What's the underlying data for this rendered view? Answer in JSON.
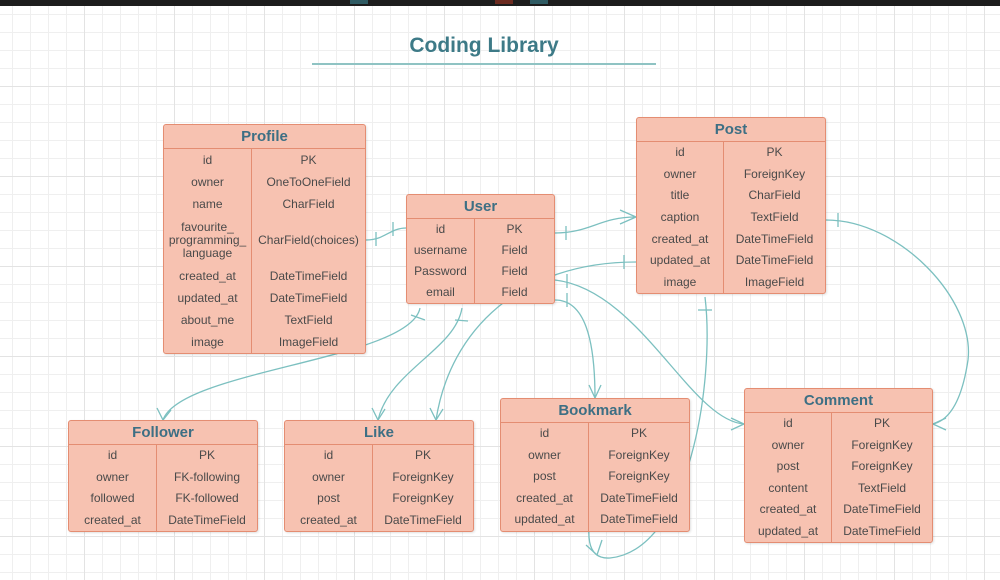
{
  "diagram": {
    "title": "Coding Library",
    "colors": {
      "entity_fill": "#f7c2b1",
      "entity_border": "#e48d72",
      "header_text": "#3d6f84",
      "connector": "#7cc0c0",
      "title": "#3d7a87"
    }
  },
  "entities": {
    "profile": {
      "name": "Profile",
      "fields": [
        {
          "field": "id",
          "type": "PK"
        },
        {
          "field": "owner",
          "type": "OneToOneField"
        },
        {
          "field": "name",
          "type": "CharField"
        },
        {
          "field": "favourite_\nprogramming_\nlanguage",
          "type": "CharField(choices)"
        },
        {
          "field": "created_at",
          "type": "DateTimeField"
        },
        {
          "field": "updated_at",
          "type": "DateTimeField"
        },
        {
          "field": "about_me",
          "type": "TextField"
        },
        {
          "field": "image",
          "type": "ImageField"
        }
      ]
    },
    "user": {
      "name": "User",
      "fields": [
        {
          "field": "id",
          "type": "PK"
        },
        {
          "field": "username",
          "type": "Field"
        },
        {
          "field": "Password",
          "type": "Field"
        },
        {
          "field": "email",
          "type": "Field"
        }
      ]
    },
    "post": {
      "name": "Post",
      "fields": [
        {
          "field": "id",
          "type": "PK"
        },
        {
          "field": "owner",
          "type": "ForeignKey"
        },
        {
          "field": "title",
          "type": "CharField"
        },
        {
          "field": "caption",
          "type": "TextField"
        },
        {
          "field": "created_at",
          "type": "DateTimeField"
        },
        {
          "field": "updated_at",
          "type": "DateTimeField"
        },
        {
          "field": "image",
          "type": "ImageField"
        }
      ]
    },
    "follower": {
      "name": "Follower",
      "fields": [
        {
          "field": "id",
          "type": "PK"
        },
        {
          "field": "owner",
          "type": "FK-following"
        },
        {
          "field": "followed",
          "type": "FK-followed"
        },
        {
          "field": "created_at",
          "type": "DateTimeField"
        }
      ]
    },
    "like": {
      "name": "Like",
      "fields": [
        {
          "field": "id",
          "type": "PK"
        },
        {
          "field": "owner",
          "type": "ForeignKey"
        },
        {
          "field": "post",
          "type": "ForeignKey"
        },
        {
          "field": "created_at",
          "type": "DateTimeField"
        }
      ]
    },
    "bookmark": {
      "name": "Bookmark",
      "fields": [
        {
          "field": "id",
          "type": "PK"
        },
        {
          "field": "owner",
          "type": "ForeignKey"
        },
        {
          "field": "post",
          "type": "ForeignKey"
        },
        {
          "field": "created_at",
          "type": "DateTimeField"
        },
        {
          "field": "updated_at",
          "type": "DateTimeField"
        }
      ]
    },
    "comment": {
      "name": "Comment",
      "fields": [
        {
          "field": "id",
          "type": "PK"
        },
        {
          "field": "owner",
          "type": "ForeignKey"
        },
        {
          "field": "post",
          "type": "ForeignKey"
        },
        {
          "field": "content",
          "type": "TextField"
        },
        {
          "field": "created_at",
          "type": "DateTimeField"
        },
        {
          "field": "updated_at",
          "type": "DateTimeField"
        }
      ]
    }
  }
}
